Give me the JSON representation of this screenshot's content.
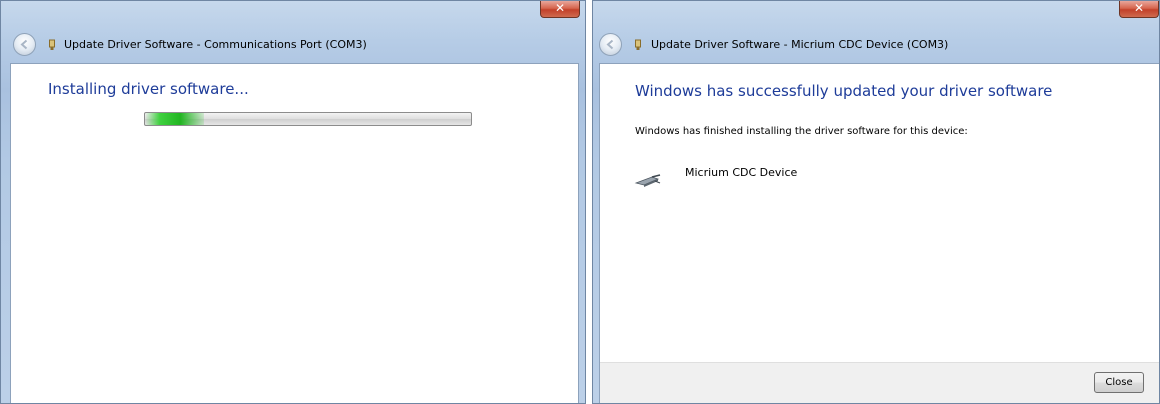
{
  "left_window": {
    "close_glyph": "✕",
    "nav_title": "Update Driver Software - Communications Port (COM3)",
    "heading": "Installing driver software...",
    "progress": {
      "fill_start_fraction": 0.0,
      "fill_end_fraction": 0.18,
      "color": "#2fc12f"
    }
  },
  "right_window": {
    "close_glyph": "✕",
    "nav_title": "Update Driver Software - Micrium CDC Device (COM3)",
    "heading": "Windows has successfully updated your driver software",
    "message": "Windows has finished installing the driver software for this device:",
    "device_name": "Micrium CDC Device",
    "device_icon": "serial-cable-icon",
    "close_button_label": "Close"
  },
  "colors": {
    "heading": "#1e3c99",
    "chrome": "#b6cce6",
    "close_button": "#c2412a"
  }
}
